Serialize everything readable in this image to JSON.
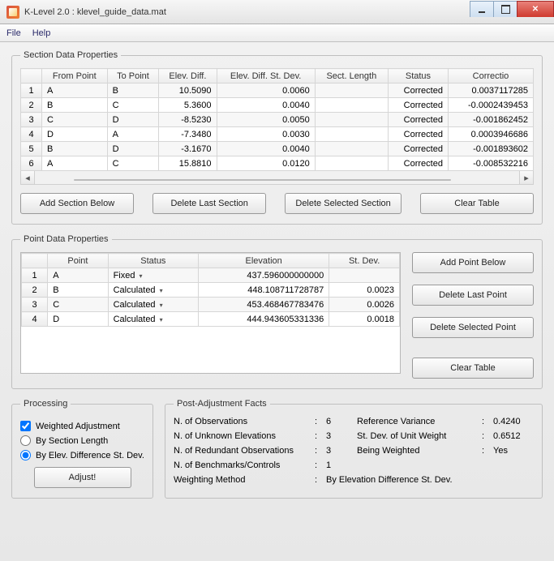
{
  "window": {
    "title": "K-Level 2.0 : klevel_guide_data.mat"
  },
  "menu": {
    "file": "File",
    "help": "Help"
  },
  "section": {
    "legend": "Section Data Properties",
    "headers": [
      "From Point",
      "To Point",
      "Elev. Diff.",
      "Elev. Diff. St. Dev.",
      "Sect. Length",
      "Status",
      "Correctio"
    ],
    "rows": [
      {
        "n": "1",
        "from": "A",
        "to": "B",
        "diff": "10.5090",
        "sd": "0.0060",
        "len": "",
        "status": "Corrected",
        "corr": "0.0037117285"
      },
      {
        "n": "2",
        "from": "B",
        "to": "C",
        "diff": "5.3600",
        "sd": "0.0040",
        "len": "",
        "status": "Corrected",
        "corr": "-0.0002439453"
      },
      {
        "n": "3",
        "from": "C",
        "to": "D",
        "diff": "-8.5230",
        "sd": "0.0050",
        "len": "",
        "status": "Corrected",
        "corr": "-0.001862452"
      },
      {
        "n": "4",
        "from": "D",
        "to": "A",
        "diff": "-7.3480",
        "sd": "0.0030",
        "len": "",
        "status": "Corrected",
        "corr": "0.0003946686"
      },
      {
        "n": "5",
        "from": "B",
        "to": "D",
        "diff": "-3.1670",
        "sd": "0.0040",
        "len": "",
        "status": "Corrected",
        "corr": "-0.001893602"
      },
      {
        "n": "6",
        "from": "A",
        "to": "C",
        "diff": "15.8810",
        "sd": "0.0120",
        "len": "",
        "status": "Corrected",
        "corr": "-0.008532216"
      }
    ],
    "buttons": {
      "add": "Add Section Below",
      "del": "Delete Last Section",
      "delsel": "Delete Selected Section",
      "clear": "Clear Table"
    }
  },
  "points": {
    "legend": "Point Data Properties",
    "headers": [
      "Point",
      "Status",
      "Elevation",
      "St. Dev."
    ],
    "rows": [
      {
        "n": "1",
        "pt": "A",
        "st": "Fixed",
        "elev": "437.596000000000",
        "sd": ""
      },
      {
        "n": "2",
        "pt": "B",
        "st": "Calculated",
        "elev": "448.108711728787",
        "sd": "0.0023"
      },
      {
        "n": "3",
        "pt": "C",
        "st": "Calculated",
        "elev": "453.468467783476",
        "sd": "0.0026"
      },
      {
        "n": "4",
        "pt": "D",
        "st": "Calculated",
        "elev": "444.943605331336",
        "sd": "0.0018"
      }
    ],
    "buttons": {
      "add": "Add Point Below",
      "del": "Delete Last Point",
      "delsel": "Delete Selected Point",
      "clear": "Clear Table"
    }
  },
  "processing": {
    "legend": "Processing",
    "weighted": "Weighted Adjustment",
    "bylen": "By Section Length",
    "bysd": "By Elev. Difference St. Dev.",
    "adjust": "Adjust!"
  },
  "facts": {
    "legend": "Post-Adjustment Facts",
    "items": {
      "nobs_l": "N. of Observations",
      "nobs_v": "6",
      "nunk_l": "N. of Unknown Elevations",
      "nunk_v": "3",
      "nred_l": "N. of Redundant Observations",
      "nred_v": "3",
      "nbm_l": "N. of Benchmarks/Controls",
      "nbm_v": "1",
      "wm_l": "Weighting Method",
      "wm_v": "By Elevation Difference St. Dev.",
      "rv_l": "Reference Variance",
      "rv_v": "0.4240",
      "sduw_l": "St. Dev. of Unit Weight",
      "sduw_v": "0.6512",
      "bw_l": "Being Weighted",
      "bw_v": "Yes"
    }
  }
}
